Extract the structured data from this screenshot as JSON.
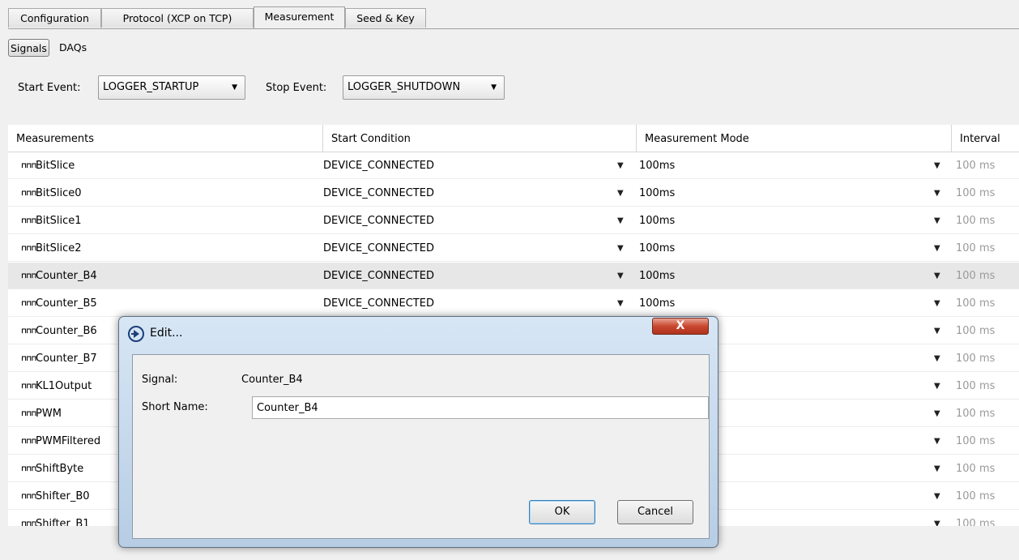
{
  "tabs": [
    {
      "label": "Configuration"
    },
    {
      "label": "Protocol (XCP on TCP)"
    },
    {
      "label": "Measurement"
    },
    {
      "label": "Seed & Key"
    }
  ],
  "active_tab": "Measurement",
  "subtabs": [
    {
      "label": "Signals"
    },
    {
      "label": "DAQs"
    }
  ],
  "active_subtab": "Signals",
  "events": {
    "start_label": "Start Event:",
    "start_value": "LOGGER_STARTUP",
    "stop_label": "Stop Event:",
    "stop_value": "LOGGER_SHUTDOWN"
  },
  "table": {
    "columns": [
      "Measurements",
      "Start Condition",
      "Measurement Mode",
      "Interval"
    ],
    "rows": [
      {
        "name": "BitSlice",
        "start": "DEVICE_CONNECTED",
        "mode": "100ms",
        "interval": "100 ms"
      },
      {
        "name": "BitSlice0",
        "start": "DEVICE_CONNECTED",
        "mode": "100ms",
        "interval": "100 ms"
      },
      {
        "name": "BitSlice1",
        "start": "DEVICE_CONNECTED",
        "mode": "100ms",
        "interval": "100 ms"
      },
      {
        "name": "BitSlice2",
        "start": "DEVICE_CONNECTED",
        "mode": "100ms",
        "interval": "100 ms"
      },
      {
        "name": "Counter_B4",
        "start": "DEVICE_CONNECTED",
        "mode": "100ms",
        "interval": "100 ms"
      },
      {
        "name": "Counter_B5",
        "start": "DEVICE_CONNECTED",
        "mode": "100ms",
        "interval": "100 ms"
      },
      {
        "name": "Counter_B6",
        "start": "",
        "mode": "",
        "interval": "100 ms"
      },
      {
        "name": "Counter_B7",
        "start": "",
        "mode": "",
        "interval": "100 ms"
      },
      {
        "name": "KL1Output",
        "start": "",
        "mode": "",
        "interval": "100 ms"
      },
      {
        "name": "PWM",
        "start": "",
        "mode": "",
        "interval": "100 ms"
      },
      {
        "name": "PWMFiltered",
        "start": "",
        "mode": "",
        "interval": "100 ms"
      },
      {
        "name": "ShiftByte",
        "start": "",
        "mode": "",
        "interval": "100 ms"
      },
      {
        "name": "Shifter_B0",
        "start": "",
        "mode": "",
        "interval": "100 ms"
      },
      {
        "name": "Shifter_B1",
        "start": "",
        "mode": "",
        "interval": "100 ms"
      }
    ],
    "selected_row": "Counter_B4"
  },
  "dialog": {
    "title": "Edit...",
    "close_label": "X",
    "signal_label": "Signal:",
    "signal_value": "Counter_B4",
    "short_name_label": "Short Name:",
    "short_name_value": "Counter_B4",
    "ok_label": "OK",
    "cancel_label": "Cancel"
  },
  "icons": {
    "signal": "signal-wave-icon",
    "dropdown": "chevron-down-icon",
    "app_logo": "app-logo-icon"
  }
}
